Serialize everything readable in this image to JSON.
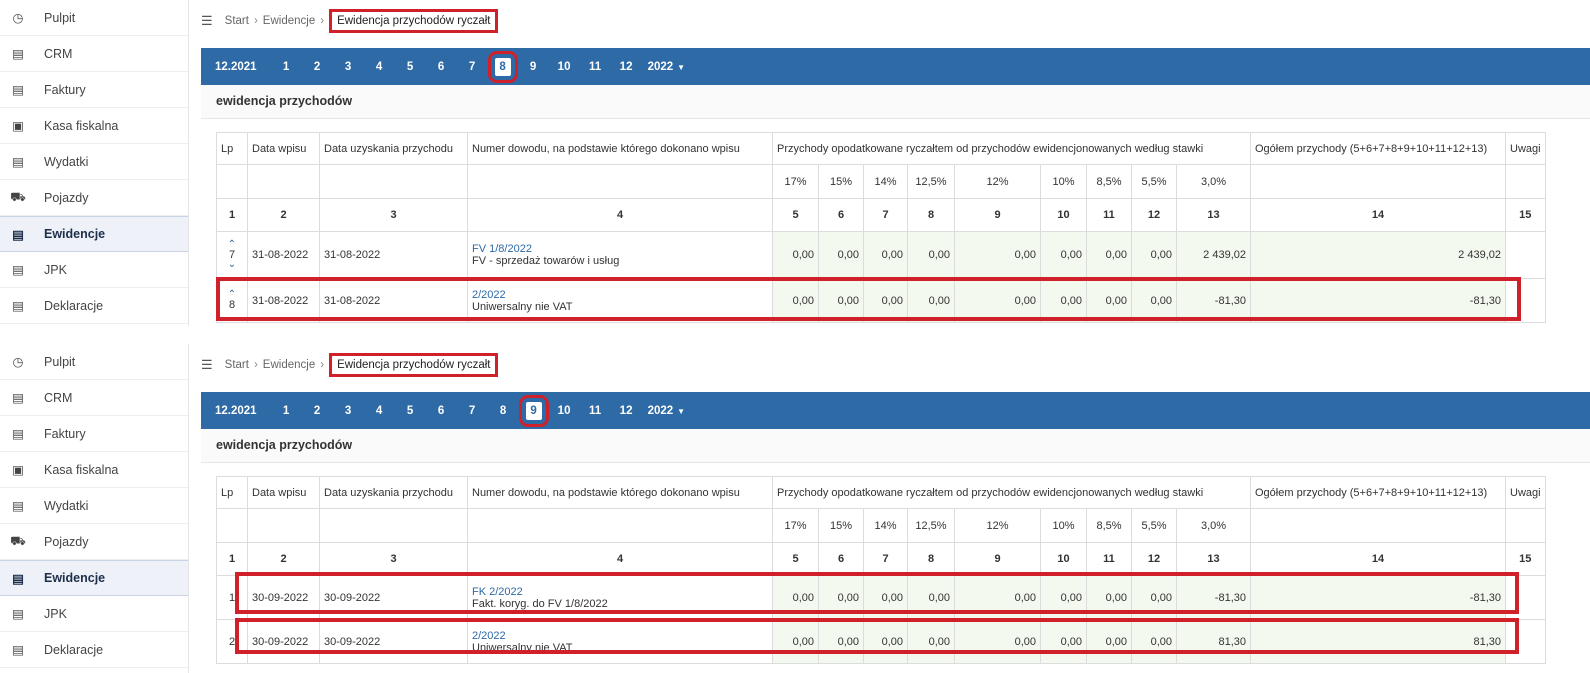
{
  "sidebar": {
    "items": [
      {
        "label": "Pulpit",
        "icon": "dashboard-icon"
      },
      {
        "label": "CRM",
        "icon": "crm-icon"
      },
      {
        "label": "Faktury",
        "icon": "invoice-icon"
      },
      {
        "label": "Kasa fiskalna",
        "icon": "cash-register-icon"
      },
      {
        "label": "Wydatki",
        "icon": "receipt-icon"
      },
      {
        "label": "Pojazdy",
        "icon": "car-icon"
      },
      {
        "label": "Ewidencje",
        "icon": "register-icon",
        "active": true
      },
      {
        "label": "JPK",
        "icon": "jpk-icon"
      },
      {
        "label": "Deklaracje",
        "icon": "declaration-icon"
      }
    ]
  },
  "breadcrumb": {
    "start": "Start",
    "level2": "Ewidencje",
    "current": "Ewidencja przychodów ryczałt"
  },
  "months": {
    "year_start": "12.2021",
    "items": [
      "1",
      "2",
      "3",
      "4",
      "5",
      "6",
      "7",
      "8",
      "9",
      "10",
      "11",
      "12"
    ],
    "year_dropdown": "2022"
  },
  "section_title": "ewidencja przychodów",
  "table": {
    "headers": {
      "lp": "Lp",
      "data_wpisu": "Data wpisu",
      "data_uzyskania": "Data uzyskania przychodu",
      "numer_dowodu": "Numer dowodu, na podstawie którego dokonano wpisu",
      "przychody": "Przychody opodatkowane ryczałtem od przychodów ewidencjonowanych według stawki",
      "ogolem": "Ogółem przychody (5+6+7+8+9+10+11+12+13)",
      "uwagi": "Uwagi"
    },
    "rates": [
      "17%",
      "15%",
      "14%",
      "12,5%",
      "12%",
      "10%",
      "8,5%",
      "5,5%",
      "3,0%"
    ],
    "col_numbers": [
      "1",
      "2",
      "3",
      "4",
      "5",
      "6",
      "7",
      "8",
      "9",
      "10",
      "11",
      "12",
      "13",
      "14",
      "15"
    ]
  },
  "panels": [
    {
      "active_month": "8",
      "rows": [
        {
          "lp": "7",
          "data_wpisu": "31-08-2022",
          "data_uzyskania": "31-08-2022",
          "doc_number": "FV 1/8/2022",
          "doc_desc": "FV - sprzedaż towarów i usług",
          "values": [
            "0,00",
            "0,00",
            "0,00",
            "0,00",
            "0,00",
            "0,00",
            "0,00",
            "0,00",
            "2 439,02"
          ],
          "total": "2 439,02",
          "arrows": "both"
        },
        {
          "lp": "8",
          "data_wpisu": "31-08-2022",
          "data_uzyskania": "31-08-2022",
          "doc_number": "2/2022",
          "doc_desc": "Uniwersalny nie VAT",
          "values": [
            "0,00",
            "0,00",
            "0,00",
            "0,00",
            "0,00",
            "0,00",
            "0,00",
            "0,00",
            "-81,30"
          ],
          "total": "-81,30",
          "arrows": "up"
        }
      ]
    },
    {
      "active_month": "9",
      "rows": [
        {
          "lp": "1",
          "data_wpisu": "30-09-2022",
          "data_uzyskania": "30-09-2022",
          "doc_number": "FK 2/2022",
          "doc_desc": "Fakt. koryg. do FV 1/8/2022",
          "values": [
            "0,00",
            "0,00",
            "0,00",
            "0,00",
            "0,00",
            "0,00",
            "0,00",
            "0,00",
            "-81,30"
          ],
          "total": "-81,30",
          "arrows": "none"
        },
        {
          "lp": "2",
          "data_wpisu": "30-09-2022",
          "data_uzyskania": "30-09-2022",
          "doc_number": "2/2022",
          "doc_desc": "Uniwersalny nie VAT",
          "values": [
            "0,00",
            "0,00",
            "0,00",
            "0,00",
            "0,00",
            "0,00",
            "0,00",
            "0,00",
            "81,30"
          ],
          "total": "81,30",
          "arrows": "none"
        }
      ]
    }
  ],
  "colors": {
    "accent": "#2d6aa6",
    "highlight": "#d0202a",
    "value_bg": "#f4f9f0"
  }
}
